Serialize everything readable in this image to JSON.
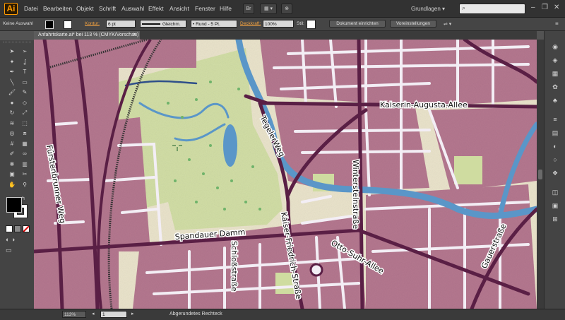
{
  "app": {
    "logo": "Ai"
  },
  "menus": [
    "Datei",
    "Bearbeiten",
    "Objekt",
    "Schrift",
    "Auswahl",
    "Effekt",
    "Ansicht",
    "Fenster",
    "Hilfe"
  ],
  "menubar_buttons": {
    "br": "Br",
    "arrange": "▦ ▾",
    "gpu": "⊗"
  },
  "workspace": {
    "label": "Grundlagen ▾",
    "search_placeholder": ""
  },
  "window_buttons": {
    "minimize": "–",
    "restore": "❐",
    "close": "✕"
  },
  "control_bar": {
    "selection_status": "Keine Auswahl",
    "stroke_label": "Kontur:",
    "stroke_weight": "6 pt",
    "profile": "Gleichm.",
    "brush": "Rund - 5 Pt.",
    "opacity_label": "Deckkraft:",
    "opacity_value": "100%",
    "style_label": "Stil:",
    "doc_setup_button": "Dokument einrichten",
    "prefs_button": "Voreinstellungen"
  },
  "document_tab": {
    "title": "Anfahrtskarte.ai* bei 113 % (CMYK/Vorschau)",
    "close": "✕"
  },
  "status_bar": {
    "zoom": "113%",
    "artboard": "1",
    "tool_name": "Abgerundetes Rechteck",
    "nav_prev": "◂",
    "nav_next": "▸"
  },
  "map": {
    "streets": [
      "Kaiserin-Augusta-Allee",
      "TegelerWeg",
      "Winterstelnstraße",
      "Fürstenbrunner Weg",
      "Spandauer Damm",
      "Schloßstraße",
      "Kaiser-Friedrich-Straße",
      "Otto-Suhr-Allee",
      "Gauerstraße"
    ],
    "colors": {
      "blocks": "#b4778f",
      "roads": "#5a1f45",
      "water": "#5a96c8",
      "park": "#cfdca0",
      "background": "#e9e2c8"
    }
  },
  "tools": [
    "selection-arrow",
    "direct-selection",
    "magic-wand",
    "lasso",
    "pen",
    "type",
    "line",
    "rectangle",
    "paintbrush",
    "pencil",
    "blob-brush",
    "eraser",
    "rotate",
    "scale",
    "width",
    "free-transform",
    "shape-builder",
    "perspective",
    "mesh",
    "gradient",
    "eyedropper",
    "blend",
    "symbol-sprayer",
    "column-graph",
    "artboard",
    "slice",
    "hand",
    "zoom"
  ],
  "panel_icons": [
    "color",
    "color-guide",
    "swatches",
    "brushes",
    "symbols",
    "stroke",
    "gradient",
    "transparency",
    "appearance",
    "graphic-styles",
    "layers",
    "artboards",
    "align"
  ]
}
